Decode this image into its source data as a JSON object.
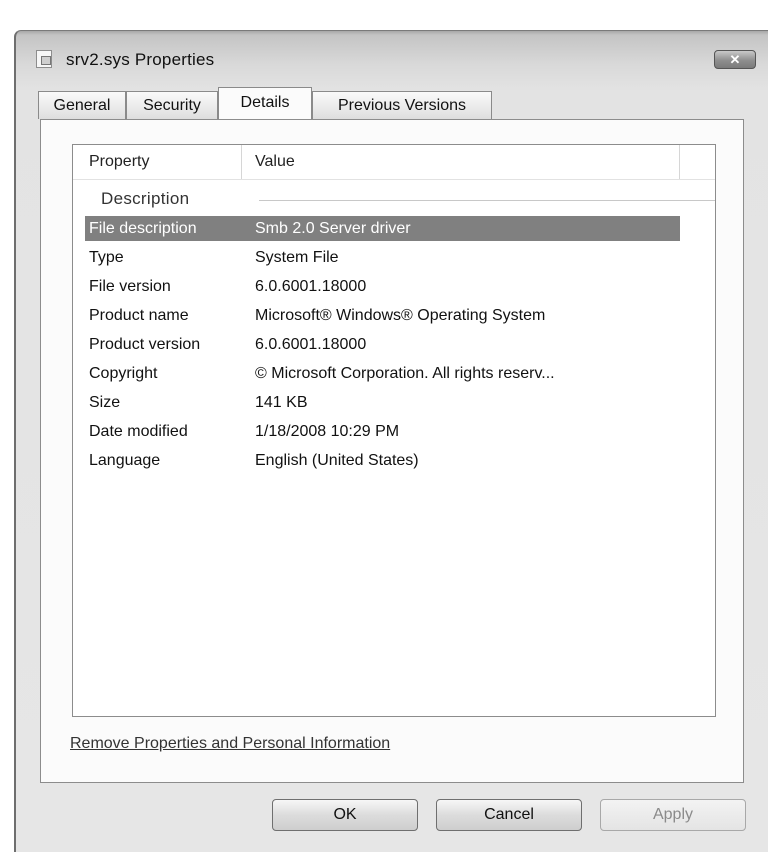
{
  "window": {
    "title": "srv2.sys Properties",
    "close_glyph": "✕"
  },
  "tabs": [
    {
      "label": "General",
      "active": false
    },
    {
      "label": "Security",
      "active": false
    },
    {
      "label": "Details",
      "active": true
    },
    {
      "label": "Previous Versions",
      "active": false
    }
  ],
  "details": {
    "columns": {
      "property": "Property",
      "value": "Value"
    },
    "group": "Description",
    "rows": [
      {
        "property": "File description",
        "value": "Smb 2.0 Server driver",
        "selected": true
      },
      {
        "property": "Type",
        "value": "System File"
      },
      {
        "property": "File version",
        "value": "6.0.6001.18000"
      },
      {
        "property": "Product name",
        "value": "Microsoft® Windows® Operating System"
      },
      {
        "property": "Product version",
        "value": "6.0.6001.18000"
      },
      {
        "property": "Copyright",
        "value": "© Microsoft Corporation. All rights reserv..."
      },
      {
        "property": "Size",
        "value": "141 KB"
      },
      {
        "property": "Date modified",
        "value": "1/18/2008 10:29 PM"
      },
      {
        "property": "Language",
        "value": "English (United States)"
      }
    ]
  },
  "link": {
    "remove_properties": "Remove Properties and Personal Information"
  },
  "buttons": {
    "ok": "OK",
    "cancel": "Cancel",
    "apply": "Apply"
  },
  "icons": {
    "app": "system-file-icon",
    "close": "close-icon"
  },
  "colors": {
    "selection": "#808080",
    "window_frame": "#cfcfcf"
  }
}
